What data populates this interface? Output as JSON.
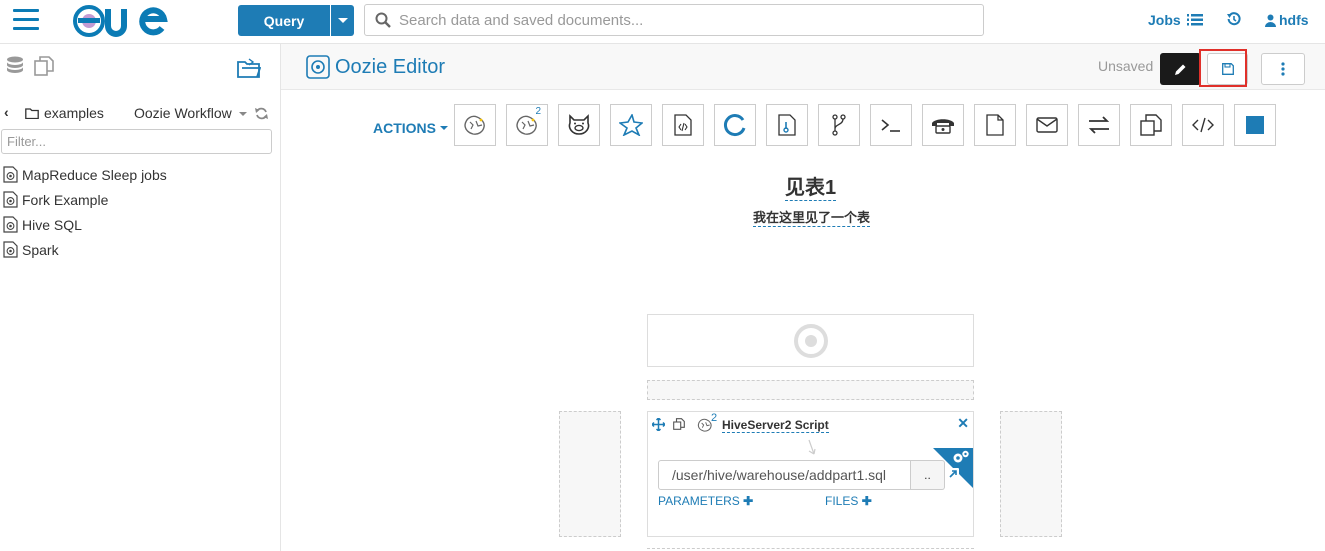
{
  "topbar": {
    "logo_text": "HUE",
    "query_label": "Query",
    "search_placeholder": "Search data and saved documents...",
    "jobs_label": "Jobs",
    "user_label": "hdfs"
  },
  "sidebar": {
    "folder_label": "examples",
    "doc_type_label": "Oozie Workflow",
    "filter_placeholder": "Filter...",
    "items": [
      {
        "label": "MapReduce Sleep jobs"
      },
      {
        "label": "Fork Example"
      },
      {
        "label": "Hive SQL"
      },
      {
        "label": "Spark"
      }
    ]
  },
  "editor": {
    "title": "Oozie Editor",
    "status": "Unsaved",
    "actions_label": "ACTIONS",
    "action_icons": [
      "hive-icon",
      "hiveserver2-icon",
      "pig-icon",
      "spark-icon",
      "java-icon",
      "sqoop-icon",
      "mapreduce-icon",
      "fork-icon",
      "shell-icon",
      "ssh-icon",
      "fs-icon",
      "email-icon",
      "distcp-icon",
      "subworkflow-icon",
      "generic-icon",
      "kill-icon"
    ],
    "action_badge": "2",
    "workflow_name": "见表1",
    "workflow_description": "我在这里见了一个表",
    "card": {
      "badge": "2",
      "title": "HiveServer2 Script",
      "script_path": "/user/hive/warehouse/addpart1.sql",
      "browse_label": "..",
      "parameters_label": "PARAMETERS",
      "files_label": "FILES"
    }
  },
  "colors": {
    "brand_blue": "#1e7cb5",
    "dark_button": "#1a1a1a",
    "highlight_red": "#e0302a"
  }
}
